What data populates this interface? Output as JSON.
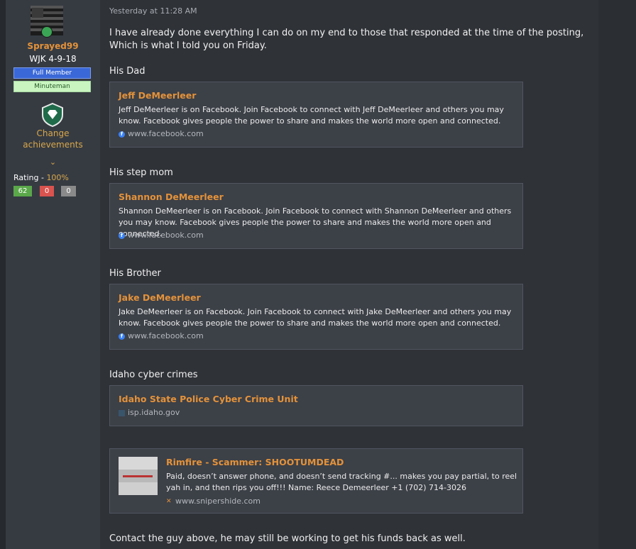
{
  "user": {
    "username": "Sprayed99",
    "title": "WJK 4-9-18",
    "banners": [
      "Full Member",
      "Minuteman"
    ],
    "change_achievements": "Change achievements",
    "rating_label": "Rating - ",
    "rating_percent": "100%",
    "rating_positive": "62",
    "rating_negative": "0",
    "rating_neutral": "0"
  },
  "post": {
    "timestamp": "Yesterday at 11:28 AM",
    "intro": "I have already done everything I can do on my end to those that responded at the time of the posting, Which is what I told you on Friday.",
    "labels": [
      "His Dad",
      "His step mom",
      "His Brother",
      "Idaho cyber crimes"
    ],
    "closing": "Contact the guy above, he may still be working to get his funds back as well."
  },
  "unfurls": [
    {
      "title": "Jeff DeMeerleer",
      "desc": "Jeff DeMeerleer is on Facebook. Join Facebook to connect with Jeff DeMeerleer and others you may know. Facebook gives people the power to share and makes the world more open and connected.",
      "domain": "www.facebook.com",
      "icon": "facebook-icon"
    },
    {
      "title": "Shannon DeMeerleer",
      "desc": "Shannon DeMeerleer is on Facebook. Join Facebook to connect with Shannon DeMeerleer and others you may know. Facebook gives people the power to share and makes the world more open and connected.",
      "domain": "www.facebook.com",
      "icon": "facebook-icon"
    },
    {
      "title": "Jake DeMeerleer",
      "desc": "Jake DeMeerleer is on Facebook. Join Facebook to connect with Jake DeMeerleer and others you may know. Facebook gives people the power to share and makes the world more open and connected.",
      "domain": "www.facebook.com",
      "icon": "facebook-icon"
    },
    {
      "title": "Idaho State Police Cyber Crime Unit",
      "domain": "isp.idaho.gov",
      "icon": "isp-icon"
    },
    {
      "title": "Rimfire - Scammer: SHOOTUMDEAD",
      "desc": "Paid, doesn’t answer phone, and doesn’t send tracking #... makes you pay partial, to reel yah in, and then rips you off!!! Name: Reece Demeerleer +1 (702) 714-3026",
      "domain": "www.snipershide.com",
      "icon": "snipershide-icon"
    }
  ],
  "colors": {
    "accent": "#e4923a",
    "banner_full": "#3a68d8",
    "banner_minuteman": "#c8f5c0",
    "rating_positive": "#5aa84a",
    "rating_negative": "#d9534f",
    "rating_neutral": "#8a8a8a"
  }
}
